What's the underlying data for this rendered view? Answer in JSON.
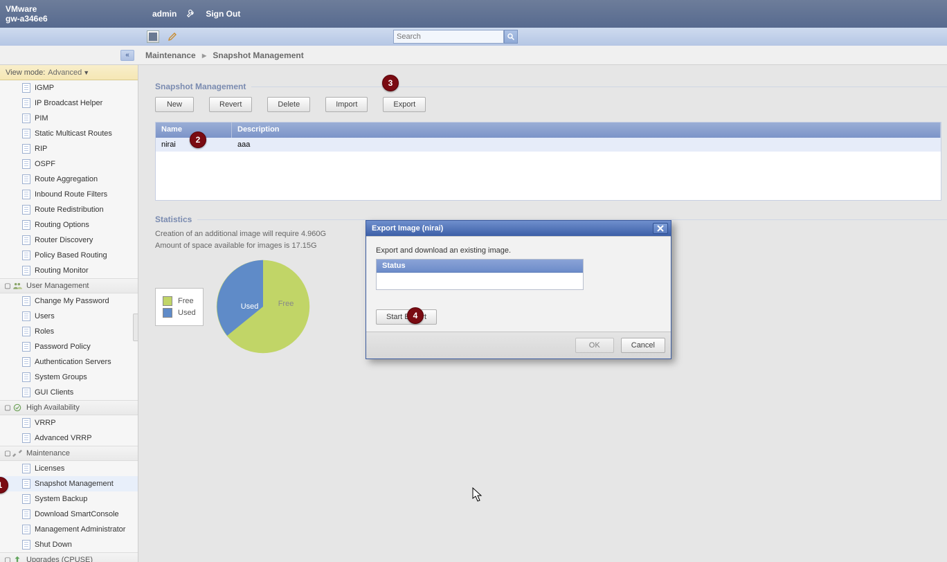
{
  "header": {
    "brand": "VMware",
    "host": "gw-a346e6",
    "user": "admin",
    "signout": "Sign Out"
  },
  "search": {
    "placeholder": "Search"
  },
  "breadcrumb": {
    "a": "Maintenance",
    "b": "Snapshot Management"
  },
  "viewmode": {
    "label": "View mode:",
    "value": "Advanced"
  },
  "sidebar": {
    "items": [
      "IGMP",
      "IP Broadcast Helper",
      "PIM",
      "Static Multicast Routes",
      "RIP",
      "OSPF",
      "Route Aggregation",
      "Inbound Route Filters",
      "Route Redistribution",
      "Routing Options",
      "Router Discovery",
      "Policy Based Routing",
      "Routing Monitor"
    ],
    "grp_user": "User Management",
    "user_items": [
      "Change My Password",
      "Users",
      "Roles",
      "Password Policy",
      "Authentication Servers",
      "System Groups",
      "GUI Clients"
    ],
    "grp_ha": "High Availability",
    "ha_items": [
      "VRRP",
      "Advanced VRRP"
    ],
    "grp_maint": "Maintenance",
    "maint_items": [
      "Licenses",
      "Snapshot Management",
      "System Backup",
      "Download SmartConsole",
      "Management Administrator",
      "Shut Down"
    ],
    "grp_upg": "Upgrades (CPUSE)"
  },
  "snapshot": {
    "title": "Snapshot Management",
    "btns": {
      "new": "New",
      "revert": "Revert",
      "delete": "Delete",
      "import": "Import",
      "export": "Export"
    },
    "cols": {
      "name": "Name",
      "desc": "Description"
    },
    "row": {
      "name": "nirai",
      "desc": "aaa"
    }
  },
  "stats": {
    "title": "Statistics",
    "l1": "Creation of an additional image will require 4.960G",
    "l2": "Amount of space available for images is 17.15G",
    "legend": {
      "free": "Free",
      "used": "Used"
    },
    "pie": {
      "used": "Used",
      "free": "Free"
    }
  },
  "chart_data": {
    "type": "pie",
    "title": "",
    "series": [
      {
        "name": "Free",
        "value": 17.15,
        "color": "#c1d567"
      },
      {
        "name": "Used",
        "value": 4.96,
        "color": "#5f8bc8"
      }
    ],
    "unit": "G"
  },
  "dialog": {
    "title": "Export Image (nirai)",
    "desc": "Export and download an existing image.",
    "status_label": "Status",
    "start": "Start Export",
    "ok": "OK",
    "cancel": "Cancel"
  },
  "markers": {
    "m1": "1",
    "m2": "2",
    "m3": "3",
    "m4": "4"
  }
}
